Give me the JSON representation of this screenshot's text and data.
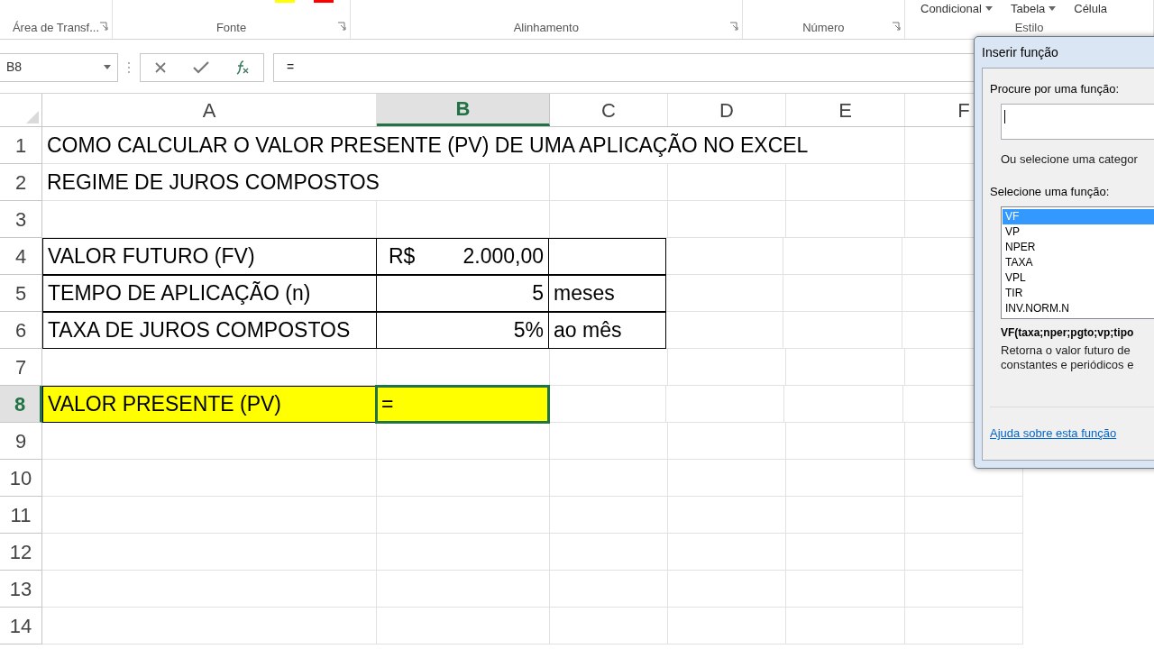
{
  "ribbon": {
    "top_items": [
      {
        "label": "Condicional"
      },
      {
        "label": "Tabela"
      },
      {
        "label": "Célula"
      }
    ],
    "groups": [
      {
        "label": "Área de Transf..."
      },
      {
        "label": "Fonte"
      },
      {
        "label": "Alinhamento"
      },
      {
        "label": "Número"
      },
      {
        "label": "Estilo"
      }
    ]
  },
  "formula_bar": {
    "name_box": "B8",
    "formula": "="
  },
  "columns": [
    {
      "label": "A",
      "selected": false
    },
    {
      "label": "B",
      "selected": true
    },
    {
      "label": "C",
      "selected": false
    },
    {
      "label": "D",
      "selected": false
    },
    {
      "label": "E",
      "selected": false
    },
    {
      "label": "F",
      "selected": false
    }
  ],
  "rows": [
    {
      "number": "1",
      "selected": false,
      "cells": [
        {
          "text": "COMO CALCULAR O VALOR PRESENTE (PV) DE UMA APLICAÇÃO NO EXCEL",
          "kind": "label",
          "bordered": false,
          "highlighted": false,
          "selected": false
        }
      ]
    },
    {
      "number": "2",
      "selected": false,
      "cells": [
        {
          "text": "REGIME DE JUROS COMPOSTOS",
          "kind": "label",
          "bordered": false,
          "highlighted": false,
          "selected": false
        }
      ]
    },
    {
      "number": "3",
      "selected": false
    },
    {
      "number": "4",
      "selected": false,
      "cells": [
        {
          "text": "VALOR FUTURO (FV)",
          "kind": "label",
          "bordered": true,
          "highlighted": false,
          "selected": false
        },
        {
          "symbol": "R$",
          "text": "2.000,00",
          "kind": "currency",
          "bordered": true,
          "highlighted": false,
          "selected": false
        },
        {
          "kind": "label",
          "bordered": true,
          "highlighted": false,
          "selected": false
        }
      ]
    },
    {
      "number": "5",
      "selected": false,
      "cells": [
        {
          "text": "TEMPO DE APLICAÇÃO (n)",
          "kind": "label",
          "bordered": true,
          "highlighted": false,
          "selected": false
        },
        {
          "text": "5",
          "kind": "number",
          "bordered": true,
          "highlighted": false,
          "selected": false
        },
        {
          "text": "meses",
          "kind": "label",
          "bordered": true,
          "highlighted": false,
          "selected": false
        }
      ]
    },
    {
      "number": "6",
      "selected": false,
      "cells": [
        {
          "text": "TAXA DE JUROS COMPOSTOS",
          "kind": "label",
          "bordered": true,
          "highlighted": false,
          "selected": false
        },
        {
          "text": "5%",
          "kind": "number",
          "bordered": true,
          "highlighted": false,
          "selected": false
        },
        {
          "text": "ao mês",
          "kind": "label",
          "bordered": true,
          "highlighted": false,
          "selected": false
        }
      ]
    },
    {
      "number": "7",
      "selected": false
    },
    {
      "number": "8",
      "selected": true,
      "cells": [
        {
          "text": "VALOR PRESENTE (PV)",
          "kind": "label",
          "bordered": true,
          "highlighted": true,
          "selected": false
        },
        {
          "text": "=",
          "kind": "label",
          "bordered": true,
          "highlighted": true,
          "selected": true
        }
      ]
    },
    {
      "number": "9",
      "selected": false
    },
    {
      "number": "10",
      "selected": false
    },
    {
      "number": "11",
      "selected": false
    },
    {
      "number": "12",
      "selected": false
    },
    {
      "number": "13",
      "selected": false
    },
    {
      "number": "14",
      "selected": false
    }
  ],
  "dialog": {
    "title": "Inserir função",
    "search_label": "Procure por uma função:",
    "category_label": "Ou selecione uma categor",
    "functions_label": "Selecione uma função:",
    "functions": [
      {
        "name": "VF",
        "selected": true
      },
      {
        "name": "VP",
        "selected": false
      },
      {
        "name": "NPER",
        "selected": false
      },
      {
        "name": "TAXA",
        "selected": false
      },
      {
        "name": "VPL",
        "selected": false
      },
      {
        "name": "TIR",
        "selected": false
      },
      {
        "name": "INV.NORM.N",
        "selected": false
      }
    ],
    "signature": "VF(taxa;nper;pgto;vp;tipo",
    "description": [
      "Retorna o valor futuro de",
      "constantes e periódicos e"
    ],
    "help_link": "Ajuda sobre esta função"
  }
}
